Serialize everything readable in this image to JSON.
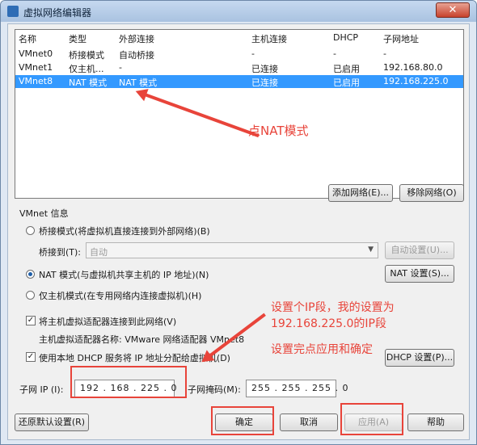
{
  "window": {
    "title": "虚拟网络编辑器",
    "close_label": "✕"
  },
  "list": {
    "headers": [
      "名称",
      "类型",
      "外部连接",
      "主机连接",
      "DHCP",
      "子网地址"
    ],
    "rows": [
      [
        "VMnet0",
        "桥接模式",
        "自动桥接",
        "-",
        "-",
        "-"
      ],
      [
        "VMnet1",
        "仅主机...",
        "-",
        "已连接",
        "已启用",
        "192.168.80.0"
      ],
      [
        "VMnet8",
        "NAT 模式",
        "NAT 模式",
        "已连接",
        "已启用",
        "192.168.225.0"
      ]
    ],
    "selected_row": 2
  },
  "buttons": {
    "add_network": "添加网络(E)...",
    "remove_network": "移除网络(O)",
    "auto_settings": "自动设置(U)...",
    "nat_settings": "NAT 设置(S)...",
    "dhcp_settings": "DHCP 设置(P)...",
    "restore_defaults": "还原默认设置(R)",
    "ok": "确定",
    "cancel": "取消",
    "apply": "应用(A)",
    "help": "帮助"
  },
  "vmnet_info": {
    "section_label": "VMnet 信息",
    "bridge_mode": "桥接模式(将虚拟机直接连接到外部网络)(B)",
    "bridge_to_label": "桥接到(T):",
    "bridge_to_value": "自动",
    "nat_mode": "NAT 模式(与虚拟机共享主机的 IP 地址)(N)",
    "host_only_mode": "仅主机模式(在专用网络内连接虚拟机)(H)",
    "connect_adapter": "将主机虚拟适配器连接到此网络(V)",
    "adapter_name": "主机虚拟适配器名称: VMware 网络适配器 VMnet8",
    "use_dhcp": "使用本地 DHCP 服务将 IP 地址分配给虚拟机(D)",
    "subnet_ip_label": "子网 IP (I):",
    "subnet_ip_value": "192 . 168 . 225 .  0",
    "subnet_mask_label": "子网掩码(M):",
    "subnet_mask_value": "255 . 255 . 255 .  0"
  },
  "annotations": {
    "click_nat": "点NAT模式",
    "set_ip_line1": "设置个IP段，我的设置为",
    "set_ip_line2": "192.168.225.0的IP段",
    "confirm": "设置完点应用和确定"
  },
  "colors": {
    "selection": "#3399ff",
    "annotation": "#e8443a"
  }
}
